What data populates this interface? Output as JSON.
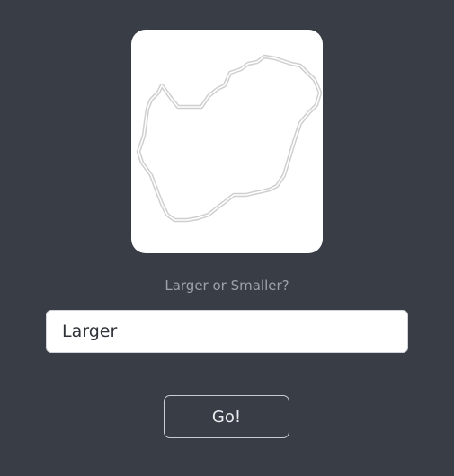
{
  "prompt": {
    "question": "Larger or Smaller?"
  },
  "answer": {
    "value": "Larger"
  },
  "actions": {
    "go_label": "Go!"
  },
  "image": {
    "subject": "country-outline-icon"
  },
  "colors": {
    "background": "#393d46",
    "card": "#ffffff",
    "text_muted": "#9da2ab",
    "button_border": "#c9ccd2"
  }
}
